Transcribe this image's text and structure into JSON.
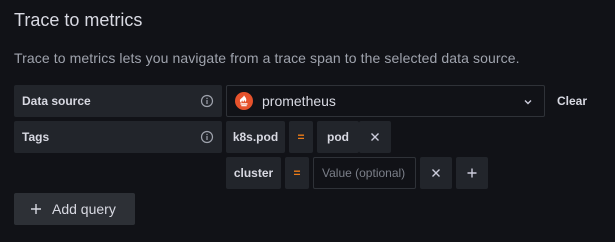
{
  "section": {
    "title": "Trace to metrics",
    "description": "Trace to metrics lets you navigate from a trace span to the selected data source."
  },
  "data_source": {
    "label": "Data source",
    "info_icon": "info-circle-icon",
    "selected": "prometheus",
    "datasource_icon": "prometheus-icon",
    "clear_label": "Clear"
  },
  "tags": {
    "label": "Tags",
    "info_icon": "info-circle-icon",
    "rows": [
      {
        "key": "k8s.pod",
        "operator": "=",
        "value": "pod"
      },
      {
        "key": "cluster",
        "operator": "=",
        "value": "",
        "placeholder": "Value (optional)"
      }
    ]
  },
  "add_query": {
    "label": "Add query",
    "icon": "plus-icon"
  },
  "colors": {
    "background": "#111217",
    "panel": "#22252b",
    "operator": "#eb7b18",
    "prometheus": "#e6522c"
  }
}
